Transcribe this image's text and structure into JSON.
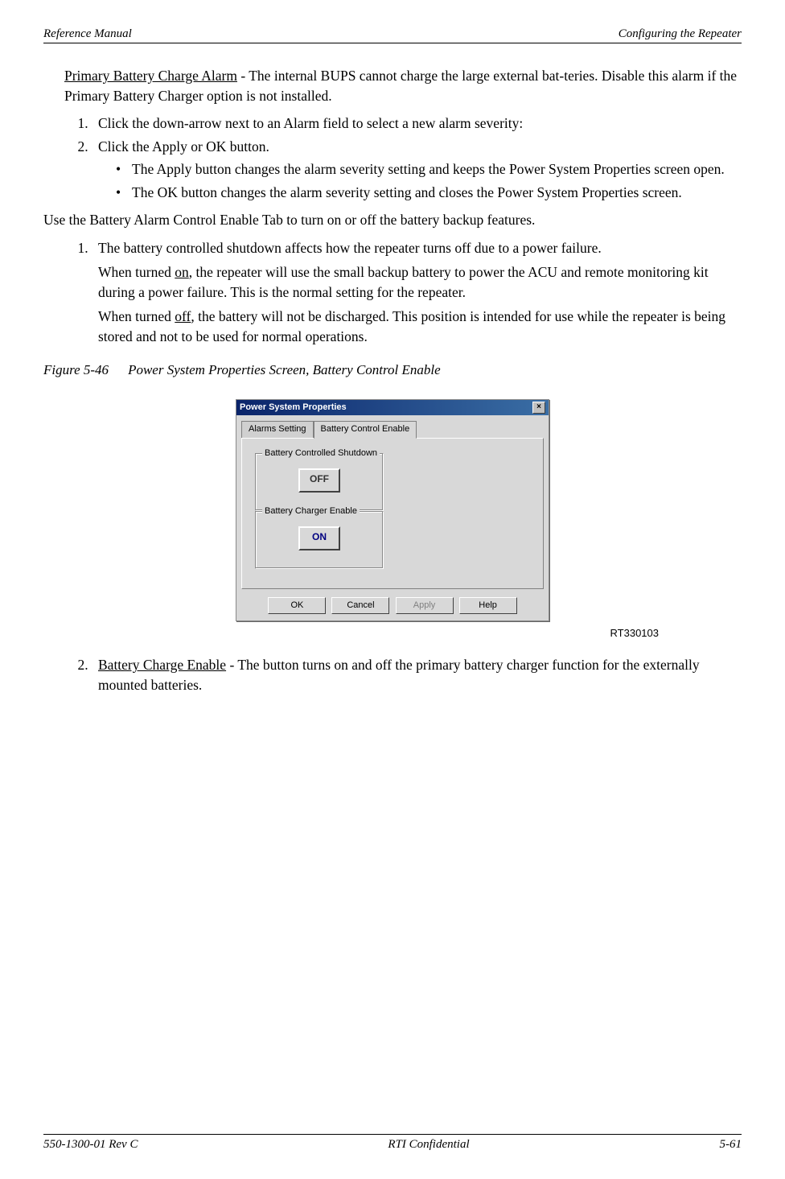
{
  "header": {
    "left": "Reference Manual",
    "right": "Configuring the Repeater"
  },
  "content": {
    "p1_lead_u": "Primary Battery Charge Alarm",
    "p1_rest": " - The internal BUPS cannot charge the large external bat-teries. Disable this alarm if the Primary Battery Charger option is not installed.",
    "list1": {
      "i1": "Click the down-arrow next to an Alarm field to select a new alarm severity:",
      "i2": "Click the Apply or OK button.",
      "b1": "The Apply button changes the alarm severity setting and keeps the Power System Properties screen open.",
      "b2": "The OK button changes the alarm severity setting and closes the Power System Properties screen."
    },
    "p2": "Use the Battery Alarm Control Enable Tab to turn on or off the battery backup features.",
    "list2": {
      "i1": "The battery controlled shutdown affects how the repeater turns off due to a power failure.",
      "i1_sub1_pre": "When turned ",
      "i1_sub1_u": "on",
      "i1_sub1_post": ", the repeater will use the small backup battery to power the ACU and remote monitoring kit during a power failure. This is the normal setting for the repeater.",
      "i1_sub2_pre": "When turned ",
      "i1_sub2_u": "off",
      "i1_sub2_post": ", the battery will not be discharged. This position is intended for use while the repeater is being stored and not to be used for normal operations."
    },
    "fig": {
      "num": "Figure 5-46",
      "title": "Power System Properties Screen, Battery Control Enable"
    },
    "dialog": {
      "title": "Power System Properties",
      "tab1": "Alarms Setting",
      "tab2": "Battery Control Enable",
      "group1": "Battery Controlled Shutdown",
      "group1_val": "OFF",
      "group2": "Battery Charger Enable",
      "group2_val": "ON",
      "ok": "OK",
      "cancel": "Cancel",
      "apply": "Apply",
      "help": "Help",
      "close": "×"
    },
    "ref": "RT330103",
    "list3": {
      "i2_lead_u": "Battery Charge Enable",
      "i2_rest": " - The button turns on and off the primary battery charger function for the externally mounted batteries."
    }
  },
  "footer": {
    "left": "550-1300-01 Rev C",
    "center": "RTI Confidential",
    "right": "5-61"
  }
}
